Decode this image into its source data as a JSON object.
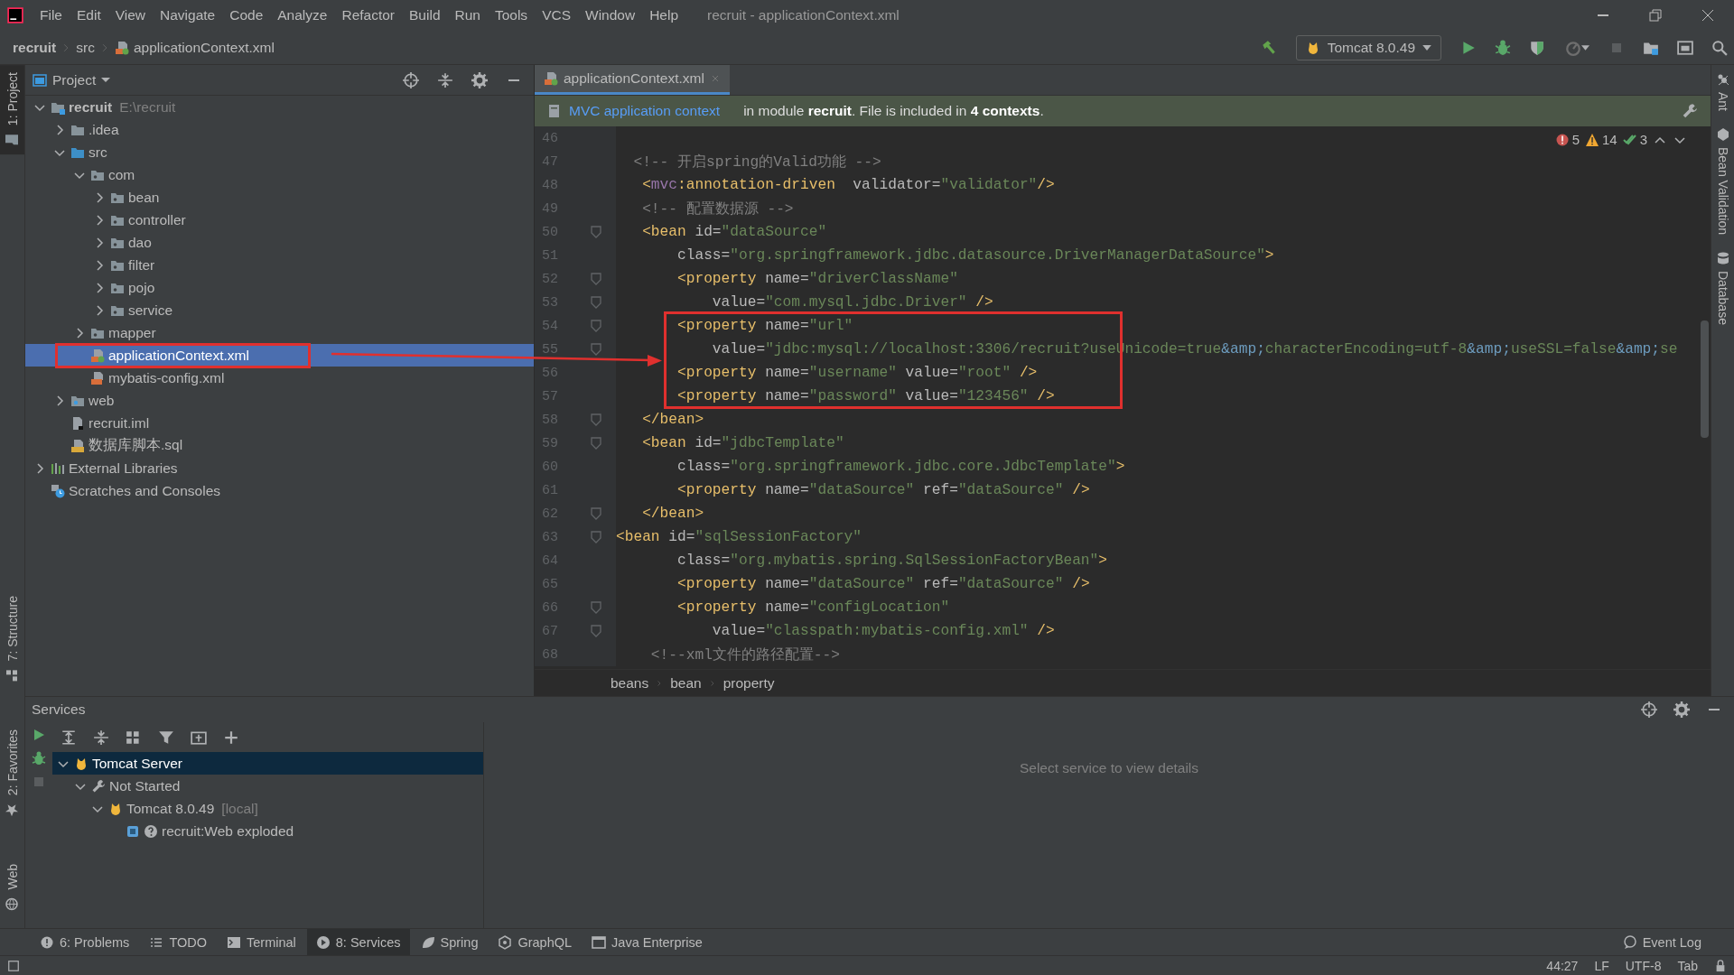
{
  "window": {
    "title": "recruit - applicationContext.xml"
  },
  "menu": [
    "File",
    "Edit",
    "View",
    "Navigate",
    "Code",
    "Analyze",
    "Refactor",
    "Build",
    "Run",
    "Tools",
    "VCS",
    "Window",
    "Help"
  ],
  "navbar": {
    "breadcrumb": [
      "recruit",
      "src",
      "applicationContext.xml"
    ],
    "run_config": "Tomcat 8.0.49"
  },
  "left_tool_windows": [
    {
      "label": "1: Project",
      "selected": true
    },
    {
      "label": "7: Structure",
      "selected": false
    },
    {
      "label": "2: Favorites",
      "selected": false
    },
    {
      "label": "Web",
      "selected": false
    }
  ],
  "right_tool_windows": [
    "Ant",
    "Bean Validation",
    "Database"
  ],
  "project": {
    "title": "Project",
    "tree": [
      {
        "label": "recruit",
        "kind": "module-folder",
        "path_hint": "E:\\recruit",
        "expanded": true,
        "selected": false,
        "children": [
          {
            "label": ".idea",
            "kind": "folder",
            "expanded": false,
            "selected": false
          },
          {
            "label": "src",
            "kind": "source-folder",
            "expanded": true,
            "selected": false,
            "children": [
              {
                "label": "com",
                "kind": "package",
                "expanded": true,
                "selected": false,
                "children": [
                  {
                    "label": "bean",
                    "kind": "package",
                    "expanded": false,
                    "selected": false
                  },
                  {
                    "label": "controller",
                    "kind": "package",
                    "expanded": false,
                    "selected": false
                  },
                  {
                    "label": "dao",
                    "kind": "package",
                    "expanded": false,
                    "selected": false
                  },
                  {
                    "label": "filter",
                    "kind": "package",
                    "expanded": false,
                    "selected": false
                  },
                  {
                    "label": "pojo",
                    "kind": "package",
                    "expanded": false,
                    "selected": false
                  },
                  {
                    "label": "service",
                    "kind": "package",
                    "expanded": false,
                    "selected": false
                  }
                ]
              },
              {
                "label": "mapper",
                "kind": "package",
                "expanded": false,
                "selected": false
              },
              {
                "label": "applicationContext.xml",
                "kind": "spring-xml",
                "selected": true
              },
              {
                "label": "mybatis-config.xml",
                "kind": "xml",
                "selected": false
              }
            ]
          },
          {
            "label": "web",
            "kind": "web-folder",
            "expanded": false,
            "selected": false
          },
          {
            "label": "recruit.iml",
            "kind": "iml",
            "selected": false
          },
          {
            "label": "数据库脚本.sql",
            "kind": "sql",
            "selected": false
          }
        ]
      },
      {
        "label": "External Libraries",
        "kind": "libraries",
        "expanded": false,
        "selected": false
      },
      {
        "label": "Scratches and Consoles",
        "kind": "scratches",
        "selected": false
      }
    ]
  },
  "editor": {
    "tabs": [
      {
        "label": "applicationContext.xml",
        "selected": true
      }
    ],
    "context_banner": {
      "link": "MVC application context",
      "message": "in module **recruit**. File is included in **4 contexts**."
    },
    "inspections": {
      "errors": "5",
      "warnings": "14",
      "passed": "3"
    },
    "lines": [
      {
        "number": "46",
        "fold": false
      },
      {
        "number": "47",
        "fold": false,
        "tokens": [
          {
            "kind": "comment",
            "text": "  <!-- 开启spring的Valid功能 -->"
          }
        ]
      },
      {
        "number": "48",
        "fold": false,
        "tokens": [
          {
            "kind": "tag",
            "text": "   <"
          },
          {
            "kind": "ns",
            "text": "mvc"
          },
          {
            "kind": "tag",
            "text": ":annotation-driven  "
          },
          {
            "kind": "attr",
            "text": "validator="
          },
          {
            "kind": "str",
            "text": "\"validator\""
          },
          {
            "kind": "tag",
            "text": "/>"
          }
        ]
      },
      {
        "number": "49",
        "fold": false,
        "tokens": [
          {
            "kind": "comment",
            "text": "   <!-- 配置数据源 -->"
          }
        ]
      },
      {
        "number": "50",
        "fold": true,
        "tokens": [
          {
            "kind": "tag",
            "text": "   <bean "
          },
          {
            "kind": "attr",
            "text": "id="
          },
          {
            "kind": "str",
            "text": "\"dataSource\""
          }
        ]
      },
      {
        "number": "51",
        "fold": false,
        "tokens": [
          {
            "kind": "attr",
            "text": "       class="
          },
          {
            "kind": "str",
            "text": "\"org.springframework.jdbc.datasource.DriverManagerDataSource\""
          },
          {
            "kind": "tag",
            "text": ">"
          }
        ]
      },
      {
        "number": "52",
        "fold": true,
        "tokens": [
          {
            "kind": "tag",
            "text": "       <property "
          },
          {
            "kind": "attr",
            "text": "name="
          },
          {
            "kind": "str",
            "text": "\"driverClassName\""
          }
        ]
      },
      {
        "number": "53",
        "fold": true,
        "tokens": [
          {
            "kind": "attr",
            "text": "           value="
          },
          {
            "kind": "str",
            "text": "\"com.mysql.jdbc.Driver\" "
          },
          {
            "kind": "tag",
            "text": "/>"
          }
        ]
      },
      {
        "number": "54",
        "fold": true,
        "tokens": [
          {
            "kind": "tag",
            "text": "       <property "
          },
          {
            "kind": "attr",
            "text": "name="
          },
          {
            "kind": "str",
            "text": "\"url\""
          }
        ]
      },
      {
        "number": "55",
        "fold": true,
        "tokens": [
          {
            "kind": "attr",
            "text": "           value="
          },
          {
            "kind": "str",
            "text": "\"jdbc:mysql://localhost:3306/recruit?useUnicode=true"
          },
          {
            "kind": "entity",
            "text": "&amp;"
          },
          {
            "kind": "str",
            "text": "characterEncoding=utf-8"
          },
          {
            "kind": "entity",
            "text": "&amp;"
          },
          {
            "kind": "str",
            "text": "useSSL=false"
          },
          {
            "kind": "entity",
            "text": "&amp;"
          },
          {
            "kind": "str",
            "text": "se"
          }
        ]
      },
      {
        "number": "56",
        "fold": false,
        "tokens": [
          {
            "kind": "tag",
            "text": "       <property "
          },
          {
            "kind": "attr",
            "text": "name="
          },
          {
            "kind": "str",
            "text": "\"username\" "
          },
          {
            "kind": "attr",
            "text": "value="
          },
          {
            "kind": "str",
            "text": "\"root\" "
          },
          {
            "kind": "tag",
            "text": "/>"
          }
        ]
      },
      {
        "number": "57",
        "fold": false,
        "tokens": [
          {
            "kind": "tag",
            "text": "       <property "
          },
          {
            "kind": "attr",
            "text": "name="
          },
          {
            "kind": "str",
            "text": "\"password\" "
          },
          {
            "kind": "attr",
            "text": "value="
          },
          {
            "kind": "str",
            "text": "\"123456\" "
          },
          {
            "kind": "tag",
            "text": "/>"
          }
        ]
      },
      {
        "number": "58",
        "fold": true,
        "tokens": [
          {
            "kind": "tag",
            "text": "   </bean>"
          }
        ]
      },
      {
        "number": "59",
        "fold": true,
        "tokens": [
          {
            "kind": "tag",
            "text": "   <bean "
          },
          {
            "kind": "attr",
            "text": "id="
          },
          {
            "kind": "str",
            "text": "\"jdbcTemplate\""
          }
        ]
      },
      {
        "number": "60",
        "fold": false,
        "tokens": [
          {
            "kind": "attr",
            "text": "       class="
          },
          {
            "kind": "str",
            "text": "\"org.springframework.jdbc.core.JdbcTemplate\""
          },
          {
            "kind": "tag",
            "text": ">"
          }
        ]
      },
      {
        "number": "61",
        "fold": false,
        "tokens": [
          {
            "kind": "tag",
            "text": "       <property "
          },
          {
            "kind": "attr",
            "text": "name="
          },
          {
            "kind": "str",
            "text": "\"dataSource\" "
          },
          {
            "kind": "attr",
            "text": "ref="
          },
          {
            "kind": "str",
            "text": "\"dataSource\" "
          },
          {
            "kind": "tag",
            "text": "/>"
          }
        ]
      },
      {
        "number": "62",
        "fold": true,
        "tokens": [
          {
            "kind": "tag",
            "text": "   </bean>"
          }
        ]
      },
      {
        "number": "63",
        "fold": true,
        "tokens": [
          {
            "kind": "tag",
            "text": "<bean "
          },
          {
            "kind": "attr",
            "text": "id="
          },
          {
            "kind": "str",
            "text": "\"sqlSessionFactory\""
          }
        ]
      },
      {
        "number": "64",
        "fold": false,
        "tokens": [
          {
            "kind": "attr",
            "text": "       class="
          },
          {
            "kind": "str",
            "text": "\"org.mybatis.spring.SqlSessionFactoryBean\""
          },
          {
            "kind": "tag",
            "text": ">"
          }
        ]
      },
      {
        "number": "65",
        "fold": false,
        "tokens": [
          {
            "kind": "tag",
            "text": "       <property "
          },
          {
            "kind": "attr",
            "text": "name="
          },
          {
            "kind": "str",
            "text": "\"dataSource\" "
          },
          {
            "kind": "attr",
            "text": "ref="
          },
          {
            "kind": "str",
            "text": "\"dataSource\" "
          },
          {
            "kind": "tag",
            "text": "/>"
          }
        ]
      },
      {
        "number": "66",
        "fold": true,
        "tokens": [
          {
            "kind": "tag",
            "text": "       <property "
          },
          {
            "kind": "attr",
            "text": "name="
          },
          {
            "kind": "str",
            "text": "\"configLocation\""
          }
        ]
      },
      {
        "number": "67",
        "fold": true,
        "tokens": [
          {
            "kind": "attr",
            "text": "           value="
          },
          {
            "kind": "str",
            "text": "\"classpath:mybatis-config.xml\" "
          },
          {
            "kind": "tag",
            "text": "/>"
          }
        ]
      },
      {
        "number": "68",
        "fold": false,
        "tokens": [
          {
            "kind": "comment",
            "text": "    <!--xml文件的路径配置-->"
          }
        ]
      }
    ],
    "breadcrumb": [
      "beans",
      "bean",
      "property"
    ]
  },
  "services": {
    "title": "Services",
    "tree": [
      {
        "label": "Tomcat Server",
        "kind": "server",
        "expanded": true,
        "selected": true,
        "children": [
          {
            "label": "Not Started",
            "kind": "status",
            "expanded": true,
            "selected": false,
            "children": [
              {
                "label": "Tomcat 8.0.49",
                "path_hint": "[local]",
                "kind": "server",
                "expanded": true,
                "selected": false,
                "children": [
                  {
                    "label": "recruit:Web exploded",
                    "kind": "artifact",
                    "selected": false
                  }
                ]
              }
            ]
          }
        ]
      }
    ],
    "empty_message": "Select service to view details"
  },
  "tool_window_bar": {
    "buttons": [
      {
        "label": "6: Problems",
        "selected": false
      },
      {
        "label": "TODO",
        "selected": false
      },
      {
        "label": "Terminal",
        "selected": false
      },
      {
        "label": "8: Services",
        "selected": true
      },
      {
        "label": "Spring",
        "selected": false
      },
      {
        "label": "GraphQL",
        "selected": false
      },
      {
        "label": "Java Enterprise",
        "selected": false
      }
    ],
    "event_log": "Event Log"
  },
  "status_bar": {
    "items": [
      "44:27",
      "LF",
      "UTF-8",
      "Tab"
    ]
  }
}
